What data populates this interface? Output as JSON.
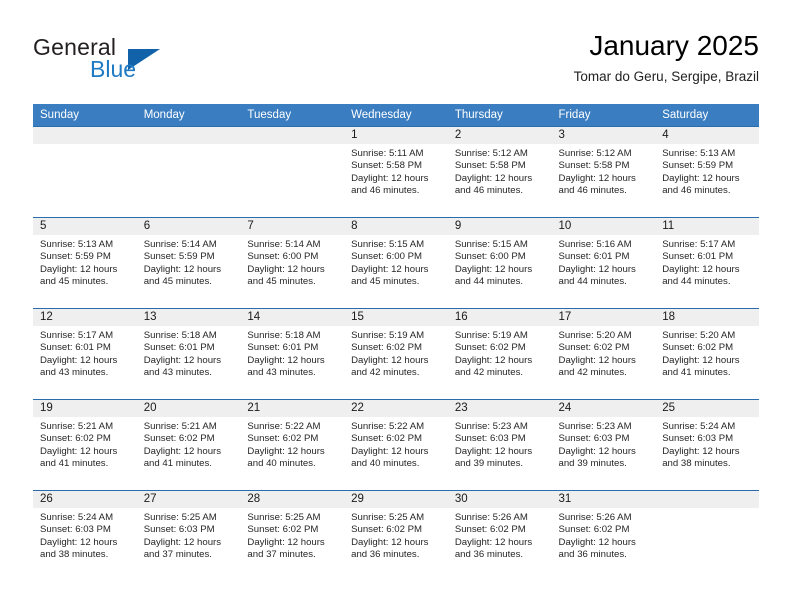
{
  "brand": {
    "name_part1": "General",
    "name_part2": "Blue",
    "triangle_color": "#1262a9",
    "blue_color": "#1f7ac4"
  },
  "header": {
    "month_title": "January 2025",
    "location": "Tomar do Geru, Sergipe, Brazil"
  },
  "theme": {
    "header_row_bg": "#3a7dc0",
    "row_border": "#2b6cad",
    "daynum_band_bg": "#efefef"
  },
  "weekday_headers": [
    "Sunday",
    "Monday",
    "Tuesday",
    "Wednesday",
    "Thursday",
    "Friday",
    "Saturday"
  ],
  "weeks": [
    [
      {
        "day": "",
        "empty": true,
        "sunrise": "",
        "sunset": "",
        "daylight_line1": "",
        "daylight_line2": ""
      },
      {
        "day": "",
        "empty": true,
        "sunrise": "",
        "sunset": "",
        "daylight_line1": "",
        "daylight_line2": ""
      },
      {
        "day": "",
        "empty": true,
        "sunrise": "",
        "sunset": "",
        "daylight_line1": "",
        "daylight_line2": ""
      },
      {
        "day": "1",
        "empty": false,
        "sunrise": "Sunrise: 5:11 AM",
        "sunset": "Sunset: 5:58 PM",
        "daylight_line1": "Daylight: 12 hours",
        "daylight_line2": "and 46 minutes."
      },
      {
        "day": "2",
        "empty": false,
        "sunrise": "Sunrise: 5:12 AM",
        "sunset": "Sunset: 5:58 PM",
        "daylight_line1": "Daylight: 12 hours",
        "daylight_line2": "and 46 minutes."
      },
      {
        "day": "3",
        "empty": false,
        "sunrise": "Sunrise: 5:12 AM",
        "sunset": "Sunset: 5:58 PM",
        "daylight_line1": "Daylight: 12 hours",
        "daylight_line2": "and 46 minutes."
      },
      {
        "day": "4",
        "empty": false,
        "sunrise": "Sunrise: 5:13 AM",
        "sunset": "Sunset: 5:59 PM",
        "daylight_line1": "Daylight: 12 hours",
        "daylight_line2": "and 46 minutes."
      }
    ],
    [
      {
        "day": "5",
        "empty": false,
        "sunrise": "Sunrise: 5:13 AM",
        "sunset": "Sunset: 5:59 PM",
        "daylight_line1": "Daylight: 12 hours",
        "daylight_line2": "and 45 minutes."
      },
      {
        "day": "6",
        "empty": false,
        "sunrise": "Sunrise: 5:14 AM",
        "sunset": "Sunset: 5:59 PM",
        "daylight_line1": "Daylight: 12 hours",
        "daylight_line2": "and 45 minutes."
      },
      {
        "day": "7",
        "empty": false,
        "sunrise": "Sunrise: 5:14 AM",
        "sunset": "Sunset: 6:00 PM",
        "daylight_line1": "Daylight: 12 hours",
        "daylight_line2": "and 45 minutes."
      },
      {
        "day": "8",
        "empty": false,
        "sunrise": "Sunrise: 5:15 AM",
        "sunset": "Sunset: 6:00 PM",
        "daylight_line1": "Daylight: 12 hours",
        "daylight_line2": "and 45 minutes."
      },
      {
        "day": "9",
        "empty": false,
        "sunrise": "Sunrise: 5:15 AM",
        "sunset": "Sunset: 6:00 PM",
        "daylight_line1": "Daylight: 12 hours",
        "daylight_line2": "and 44 minutes."
      },
      {
        "day": "10",
        "empty": false,
        "sunrise": "Sunrise: 5:16 AM",
        "sunset": "Sunset: 6:01 PM",
        "daylight_line1": "Daylight: 12 hours",
        "daylight_line2": "and 44 minutes."
      },
      {
        "day": "11",
        "empty": false,
        "sunrise": "Sunrise: 5:17 AM",
        "sunset": "Sunset: 6:01 PM",
        "daylight_line1": "Daylight: 12 hours",
        "daylight_line2": "and 44 minutes."
      }
    ],
    [
      {
        "day": "12",
        "empty": false,
        "sunrise": "Sunrise: 5:17 AM",
        "sunset": "Sunset: 6:01 PM",
        "daylight_line1": "Daylight: 12 hours",
        "daylight_line2": "and 43 minutes."
      },
      {
        "day": "13",
        "empty": false,
        "sunrise": "Sunrise: 5:18 AM",
        "sunset": "Sunset: 6:01 PM",
        "daylight_line1": "Daylight: 12 hours",
        "daylight_line2": "and 43 minutes."
      },
      {
        "day": "14",
        "empty": false,
        "sunrise": "Sunrise: 5:18 AM",
        "sunset": "Sunset: 6:01 PM",
        "daylight_line1": "Daylight: 12 hours",
        "daylight_line2": "and 43 minutes."
      },
      {
        "day": "15",
        "empty": false,
        "sunrise": "Sunrise: 5:19 AM",
        "sunset": "Sunset: 6:02 PM",
        "daylight_line1": "Daylight: 12 hours",
        "daylight_line2": "and 42 minutes."
      },
      {
        "day": "16",
        "empty": false,
        "sunrise": "Sunrise: 5:19 AM",
        "sunset": "Sunset: 6:02 PM",
        "daylight_line1": "Daylight: 12 hours",
        "daylight_line2": "and 42 minutes."
      },
      {
        "day": "17",
        "empty": false,
        "sunrise": "Sunrise: 5:20 AM",
        "sunset": "Sunset: 6:02 PM",
        "daylight_line1": "Daylight: 12 hours",
        "daylight_line2": "and 42 minutes."
      },
      {
        "day": "18",
        "empty": false,
        "sunrise": "Sunrise: 5:20 AM",
        "sunset": "Sunset: 6:02 PM",
        "daylight_line1": "Daylight: 12 hours",
        "daylight_line2": "and 41 minutes."
      }
    ],
    [
      {
        "day": "19",
        "empty": false,
        "sunrise": "Sunrise: 5:21 AM",
        "sunset": "Sunset: 6:02 PM",
        "daylight_line1": "Daylight: 12 hours",
        "daylight_line2": "and 41 minutes."
      },
      {
        "day": "20",
        "empty": false,
        "sunrise": "Sunrise: 5:21 AM",
        "sunset": "Sunset: 6:02 PM",
        "daylight_line1": "Daylight: 12 hours",
        "daylight_line2": "and 41 minutes."
      },
      {
        "day": "21",
        "empty": false,
        "sunrise": "Sunrise: 5:22 AM",
        "sunset": "Sunset: 6:02 PM",
        "daylight_line1": "Daylight: 12 hours",
        "daylight_line2": "and 40 minutes."
      },
      {
        "day": "22",
        "empty": false,
        "sunrise": "Sunrise: 5:22 AM",
        "sunset": "Sunset: 6:02 PM",
        "daylight_line1": "Daylight: 12 hours",
        "daylight_line2": "and 40 minutes."
      },
      {
        "day": "23",
        "empty": false,
        "sunrise": "Sunrise: 5:23 AM",
        "sunset": "Sunset: 6:03 PM",
        "daylight_line1": "Daylight: 12 hours",
        "daylight_line2": "and 39 minutes."
      },
      {
        "day": "24",
        "empty": false,
        "sunrise": "Sunrise: 5:23 AM",
        "sunset": "Sunset: 6:03 PM",
        "daylight_line1": "Daylight: 12 hours",
        "daylight_line2": "and 39 minutes."
      },
      {
        "day": "25",
        "empty": false,
        "sunrise": "Sunrise: 5:24 AM",
        "sunset": "Sunset: 6:03 PM",
        "daylight_line1": "Daylight: 12 hours",
        "daylight_line2": "and 38 minutes."
      }
    ],
    [
      {
        "day": "26",
        "empty": false,
        "sunrise": "Sunrise: 5:24 AM",
        "sunset": "Sunset: 6:03 PM",
        "daylight_line1": "Daylight: 12 hours",
        "daylight_line2": "and 38 minutes."
      },
      {
        "day": "27",
        "empty": false,
        "sunrise": "Sunrise: 5:25 AM",
        "sunset": "Sunset: 6:03 PM",
        "daylight_line1": "Daylight: 12 hours",
        "daylight_line2": "and 37 minutes."
      },
      {
        "day": "28",
        "empty": false,
        "sunrise": "Sunrise: 5:25 AM",
        "sunset": "Sunset: 6:02 PM",
        "daylight_line1": "Daylight: 12 hours",
        "daylight_line2": "and 37 minutes."
      },
      {
        "day": "29",
        "empty": false,
        "sunrise": "Sunrise: 5:25 AM",
        "sunset": "Sunset: 6:02 PM",
        "daylight_line1": "Daylight: 12 hours",
        "daylight_line2": "and 36 minutes."
      },
      {
        "day": "30",
        "empty": false,
        "sunrise": "Sunrise: 5:26 AM",
        "sunset": "Sunset: 6:02 PM",
        "daylight_line1": "Daylight: 12 hours",
        "daylight_line2": "and 36 minutes."
      },
      {
        "day": "31",
        "empty": false,
        "sunrise": "Sunrise: 5:26 AM",
        "sunset": "Sunset: 6:02 PM",
        "daylight_line1": "Daylight: 12 hours",
        "daylight_line2": "and 36 minutes."
      },
      {
        "day": "",
        "empty": true,
        "sunrise": "",
        "sunset": "",
        "daylight_line1": "",
        "daylight_line2": ""
      }
    ]
  ]
}
